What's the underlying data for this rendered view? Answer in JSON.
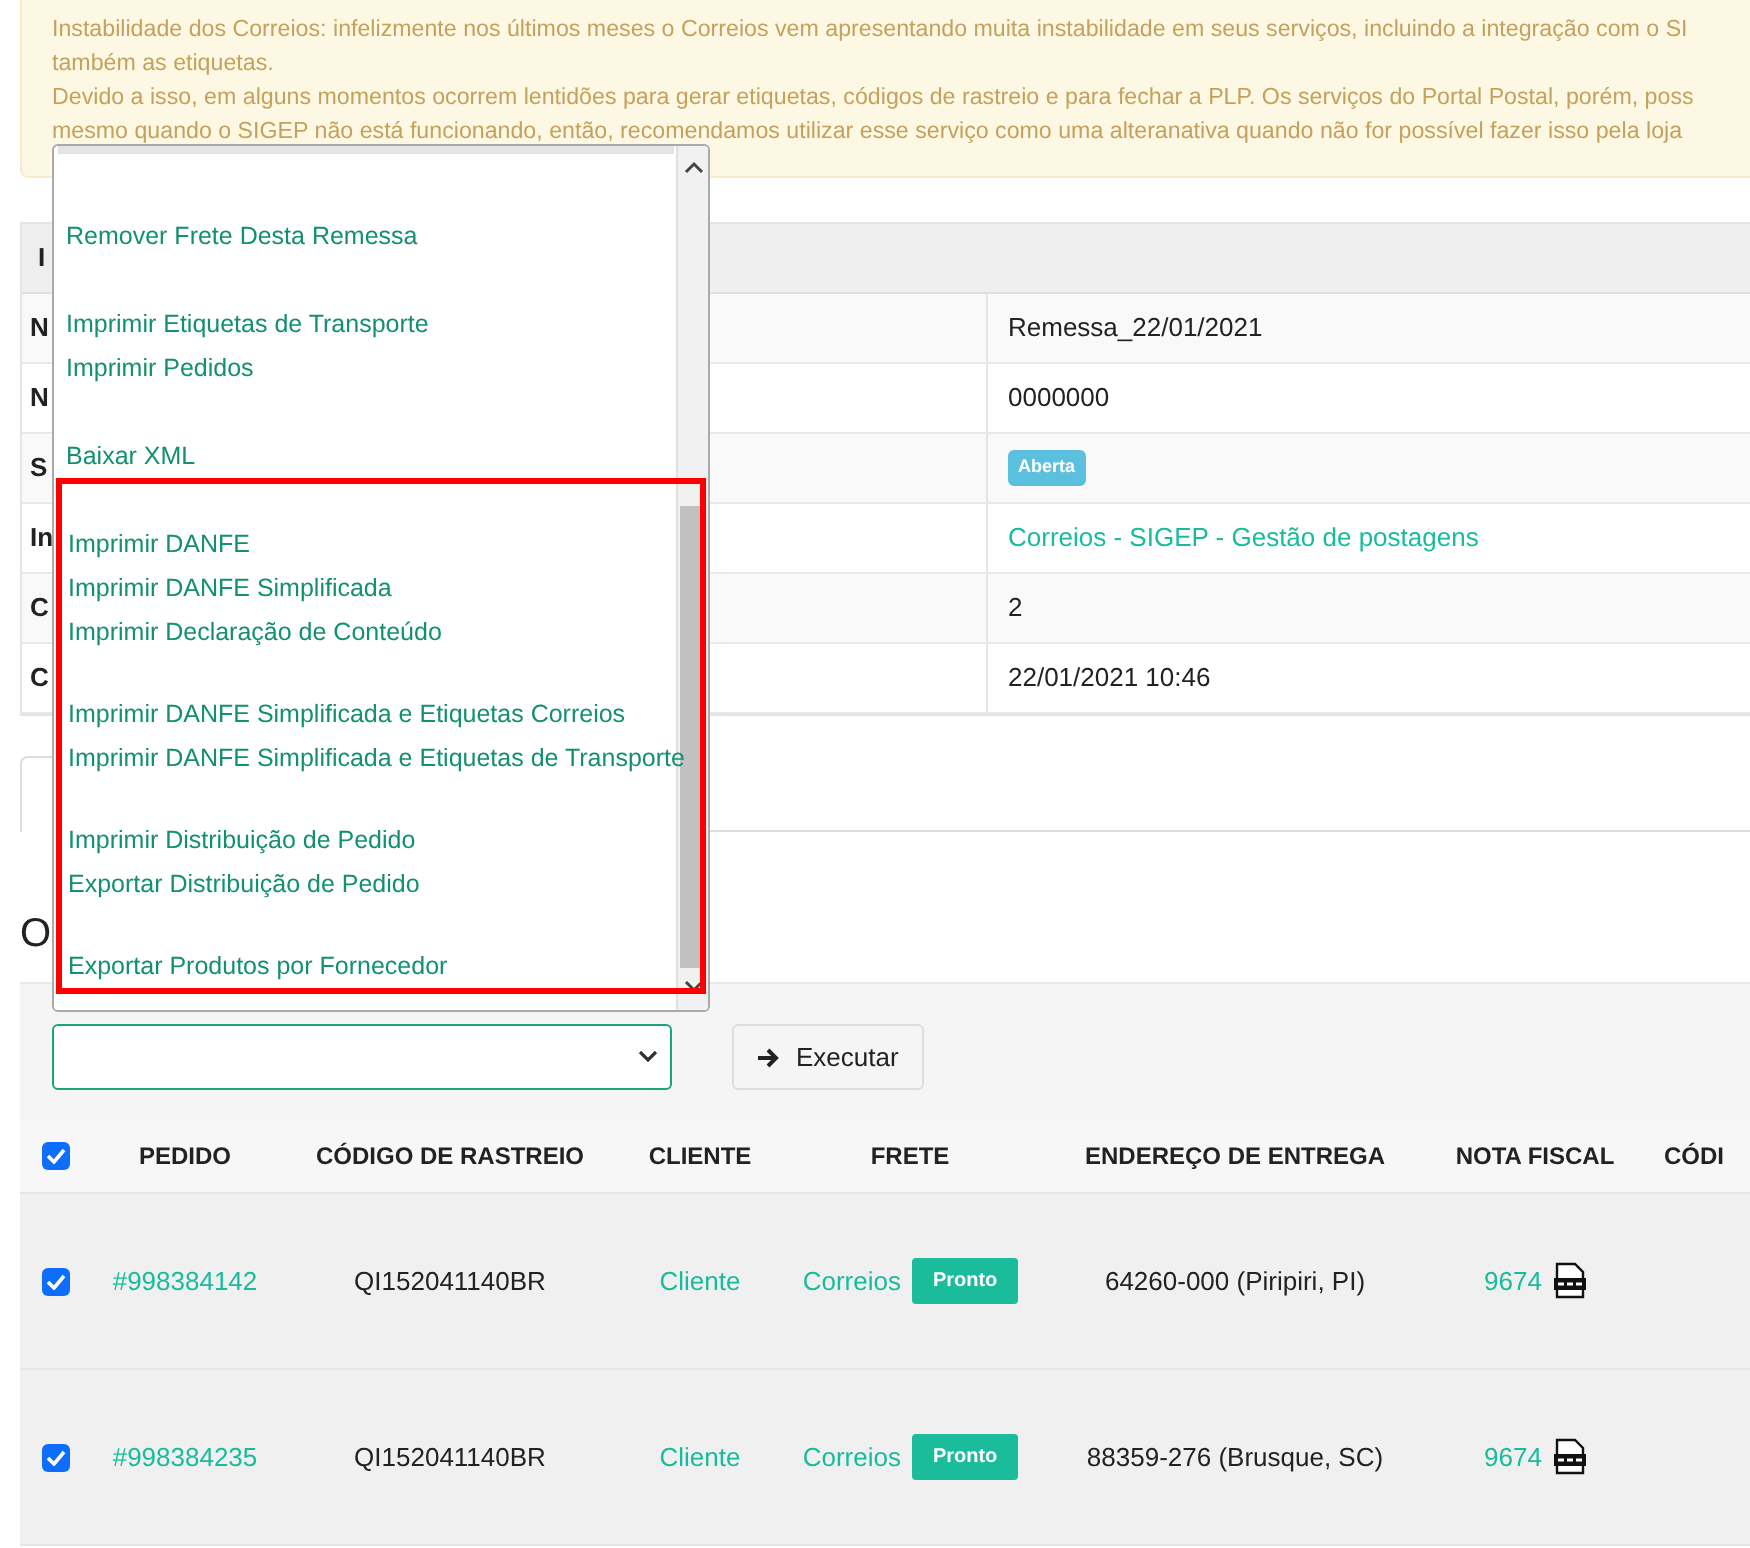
{
  "alert": {
    "lines": [
      "Instabilidade dos Correios: infelizmente nos últimos meses o Correios vem apresentando muita instabilidade em seus serviços, incluindo a integração com o SI",
      "também as etiquetas.",
      "Devido a isso, em alguns momentos ocorrem lentidões para gerar etiquetas, códigos de rastreio e para fechar a PLP. Os serviços do Portal Postal, porém, poss",
      "mesmo quando o SIGEP não está funcionando, então, recomendamos utilizar esse serviço como uma alteranativa quando não for possível fazer isso pela loja"
    ]
  },
  "info_table": {
    "header": "I",
    "rows": [
      {
        "label": "N",
        "value": "Remessa_22/01/2021",
        "kind": "text"
      },
      {
        "label": "N",
        "value": "0000000",
        "kind": "text"
      },
      {
        "label": "S",
        "value": "Aberta",
        "kind": "badge"
      },
      {
        "label": "In",
        "value": "Correios - SIGEP - Gestão de postagens",
        "kind": "link"
      },
      {
        "label": "C",
        "value": "2",
        "kind": "text"
      },
      {
        "label": "C",
        "value": "22/01/2021 10:46",
        "kind": "text"
      }
    ]
  },
  "section_heading": "O",
  "action_dropdown": {
    "expanded": true,
    "groups": [
      {
        "highlighted": false,
        "options": [
          "Remover Frete Desta Remessa"
        ]
      },
      {
        "highlighted": false,
        "options": [
          "Imprimir Etiquetas de Transporte",
          "Imprimir Pedidos"
        ]
      },
      {
        "highlighted": false,
        "options": [
          "Baixar XML"
        ]
      },
      {
        "highlighted": true,
        "options": [
          "Imprimir DANFE",
          "Imprimir DANFE Simplificada",
          "Imprimir Declaração de Conteúdo"
        ]
      },
      {
        "highlighted": true,
        "options": [
          "Imprimir DANFE Simplificada e Etiquetas Correios",
          "Imprimir DANFE Simplificada e Etiquetas de Transporte"
        ]
      },
      {
        "highlighted": true,
        "options": [
          "Imprimir Distribuição de Pedido",
          "Exportar Distribuição de Pedido"
        ]
      },
      {
        "highlighted": true,
        "options": [
          "Exportar Produtos por Fornecedor"
        ]
      }
    ]
  },
  "execute_button": "Executar",
  "orders_table": {
    "all_checked": true,
    "columns": [
      "PEDIDO",
      "CÓDIGO DE RASTREIO",
      "CLIENTE",
      "FRETE",
      "ENDEREÇO DE ENTREGA",
      "NOTA FISCAL",
      "CÓDI"
    ],
    "rows": [
      {
        "checked": true,
        "order": "#998384142",
        "tracking": "QI152041140BR",
        "client": "Cliente",
        "carrier": "Correios",
        "status": "Pronto",
        "address": "64260-000 (Piripiri, PI)",
        "invoice": "9674"
      },
      {
        "checked": true,
        "order": "#998384235",
        "tracking": "QI152041140BR",
        "client": "Cliente",
        "carrier": "Correios",
        "status": "Pronto",
        "address": "88359-276 (Brusque, SC)",
        "invoice": "9674"
      }
    ]
  }
}
